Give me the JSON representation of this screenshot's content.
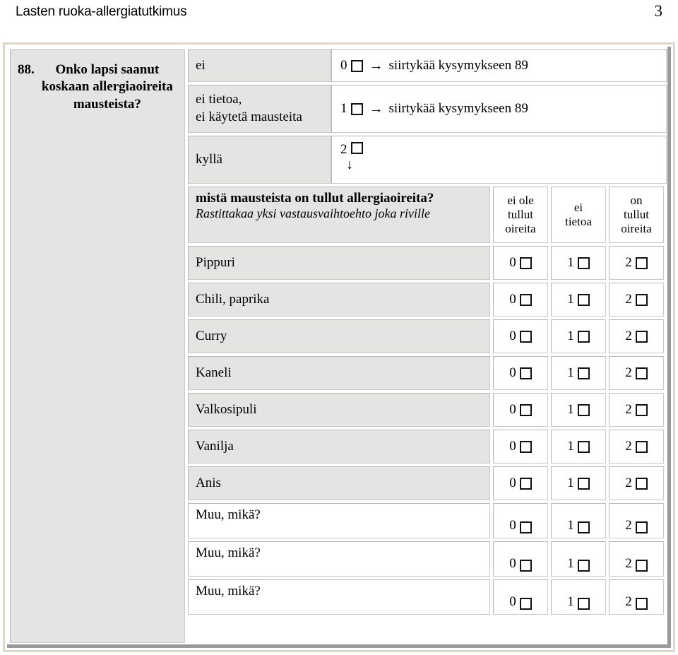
{
  "header": {
    "title": "Lasten ruoka-allergiatutkimus",
    "page_number": "3"
  },
  "question": {
    "number": "88.",
    "text": "Onko lapsi saanut koskaan allergiaoireita mausteista?",
    "options": [
      {
        "label": "ei",
        "code": "0",
        "arrow": "→",
        "skip_text": "siirtykää kysymykseen 89"
      },
      {
        "label": "ei tietoa,\nei käytetä mausteita",
        "label_line1": "ei tietoa,",
        "label_line2": "ei käytetä mausteita",
        "code": "1",
        "arrow": "→",
        "skip_text": "siirtykää kysymykseen 89"
      },
      {
        "label": "kyllä",
        "code": "2",
        "arrow": "↓",
        "skip_text": ""
      }
    ]
  },
  "subtable": {
    "heading": "mistä mausteista on tullut allergiaoireita?",
    "instruction": "Rastittakaa yksi vastausvaihtoehto joka riville",
    "columns": [
      {
        "code": "0",
        "line1": "ei ole",
        "line2": "tullut",
        "line3": "oireita"
      },
      {
        "code": "1",
        "line1": "ei",
        "line2": "tietoa",
        "line3": ""
      },
      {
        "code": "2",
        "line1": "on",
        "line2": "tullut",
        "line3": "oireita"
      }
    ],
    "rows": [
      {
        "label": "Pippuri",
        "blank": false
      },
      {
        "label": "Chili, paprika",
        "blank": false
      },
      {
        "label": "Curry",
        "blank": false
      },
      {
        "label": "Kaneli",
        "blank": false
      },
      {
        "label": "Valkosipuli",
        "blank": false
      },
      {
        "label": "Vanilja",
        "blank": false
      },
      {
        "label": "Anis",
        "blank": false
      },
      {
        "label": "Muu, mikä?",
        "blank": true
      },
      {
        "label": "Muu, mikä?",
        "blank": true
      },
      {
        "label": "Muu, mikä?",
        "blank": true
      }
    ]
  },
  "colors": {
    "cell_gray": "#e4e4e2",
    "frame_beige": "#ddd7cd",
    "shadow_gray": "#9a9a9a",
    "border_gray": "#c9c9c7"
  }
}
